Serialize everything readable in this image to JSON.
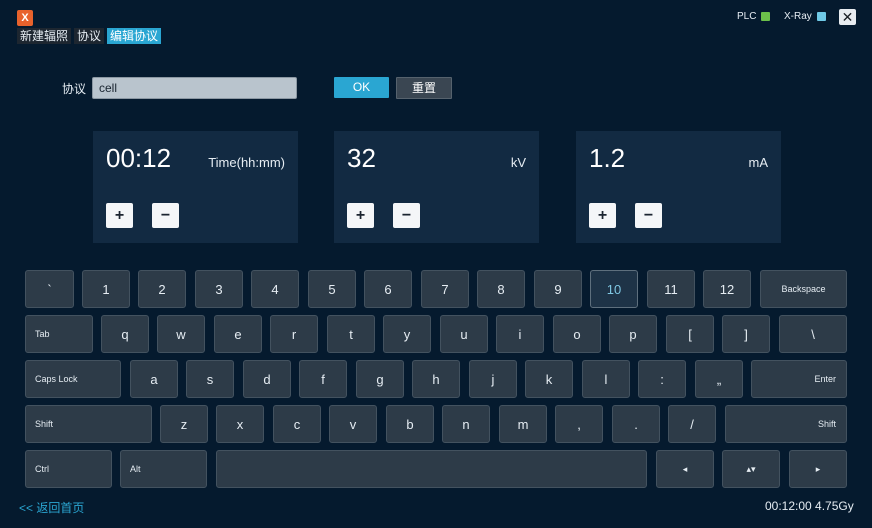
{
  "app": {
    "logo_letter": "X"
  },
  "tabs": [
    {
      "label": "新建辐照",
      "active": false
    },
    {
      "label": "协议",
      "active": false
    },
    {
      "label": "编辑协议",
      "active": true
    }
  ],
  "status": {
    "plc": {
      "label": "PLC",
      "color": "#6cc04a"
    },
    "xray": {
      "label": "X-Ray",
      "color": "#6fc9e6"
    },
    "close_label": "✕"
  },
  "protocol": {
    "label": "协议",
    "value": "cell"
  },
  "buttons": {
    "ok": "OK",
    "reset": "重置"
  },
  "cards": [
    {
      "value": "00:12",
      "unit": "Time(hh:mm)",
      "plus": "+",
      "minus": "−"
    },
    {
      "value": "32",
      "unit": "kV",
      "plus": "+",
      "minus": "−"
    },
    {
      "value": "1.2",
      "unit": "mA",
      "plus": "+",
      "minus": "−"
    }
  ],
  "keyboard": {
    "row1": [
      "`",
      "1",
      "2",
      "3",
      "4",
      "5",
      "6",
      "7",
      "8",
      "9",
      "10",
      "11",
      "12",
      "Backspace"
    ],
    "row2": [
      "Tab",
      "q",
      "w",
      "e",
      "r",
      "t",
      "y",
      "u",
      "i",
      "o",
      "p",
      "[",
      "]",
      "\\"
    ],
    "row3": [
      "Caps Lock",
      "a",
      "s",
      "d",
      "f",
      "g",
      "h",
      "j",
      "k",
      "l",
      ":",
      "„",
      "Enter"
    ],
    "row4": [
      "Shift",
      "z",
      "x",
      "c",
      "v",
      "b",
      "n",
      "m",
      ",",
      ".",
      "/",
      "Shift"
    ],
    "row5": [
      "Ctrl",
      "Alt",
      "",
      "◂",
      "▴▾",
      "▸"
    ],
    "highlighted": "10"
  },
  "footer": {
    "back": "<< 返回首页",
    "status": "00:12:00 4.75Gy"
  }
}
